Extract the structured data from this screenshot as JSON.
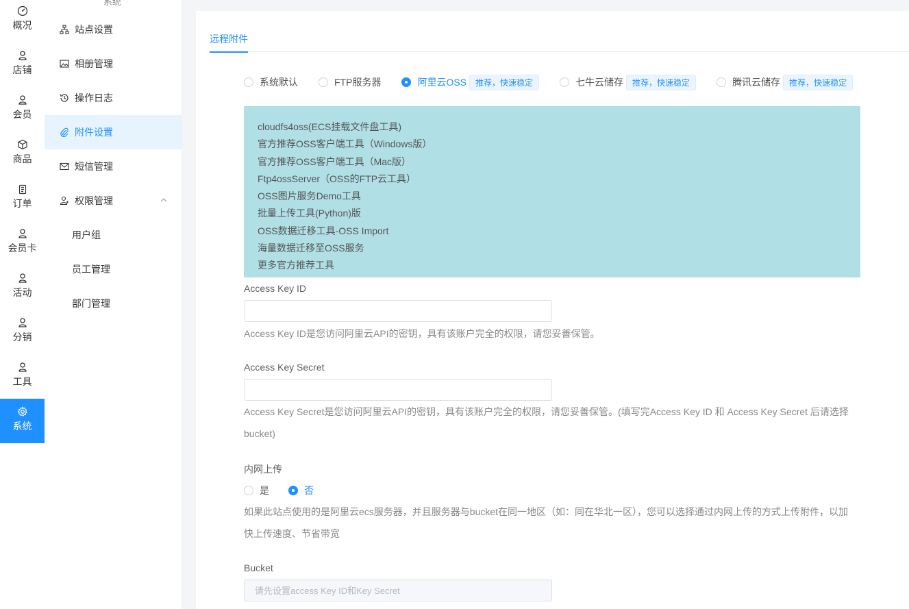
{
  "rail": {
    "items": [
      {
        "label": "概况",
        "icon": "dashboard-icon"
      },
      {
        "label": "店铺",
        "icon": "user-icon"
      },
      {
        "label": "会员",
        "icon": "user-icon"
      },
      {
        "label": "商品",
        "icon": "cube-icon"
      },
      {
        "label": "订单",
        "icon": "clipboard-icon"
      },
      {
        "label": "会员卡",
        "icon": "user-icon"
      },
      {
        "label": "活动",
        "icon": "user-icon"
      },
      {
        "label": "分销",
        "icon": "user-icon"
      },
      {
        "label": "工具",
        "icon": "user-icon"
      },
      {
        "label": "系统",
        "icon": "gear-icon",
        "active": true
      }
    ]
  },
  "sidebar": {
    "section_title": "系统",
    "items": [
      {
        "label": "站点设置",
        "icon": "sitemap-icon"
      },
      {
        "label": "相册管理",
        "icon": "image-icon"
      },
      {
        "label": "操作日志",
        "icon": "history-icon"
      },
      {
        "label": "附件设置",
        "icon": "paperclip-icon",
        "active": true
      },
      {
        "label": "短信管理",
        "icon": "mail-icon"
      },
      {
        "label": "权限管理",
        "icon": "user-group-icon",
        "expanded": true
      }
    ],
    "sub_items": [
      {
        "label": "用户组"
      },
      {
        "label": "员工管理"
      },
      {
        "label": "部门管理"
      }
    ]
  },
  "tabs": [
    {
      "label": "远程附件"
    }
  ],
  "storage_options": [
    {
      "label": "系统默认",
      "checked": false
    },
    {
      "label": "FTP服务器",
      "checked": false
    },
    {
      "label": "阿里云OSS",
      "checked": true,
      "tag": "推荐，快速稳定"
    },
    {
      "label": "七牛云储存",
      "checked": false,
      "tag": "推荐，快速稳定"
    },
    {
      "label": "腾讯云储存",
      "checked": false,
      "tag": "推荐，快速稳定"
    }
  ],
  "info_links": [
    "cloudfs4oss(ECS挂载文件盘工具)",
    "官方推荐OSS客户端工具（Windows版）",
    "官方推荐OSS客户端工具（Mac版）",
    "Ftp4ossServer（OSS的FTP云工具）",
    "OSS图片服务Demo工具",
    "批量上传工具(Python)版",
    "OSS数据迁移工具-OSS Import",
    "海量数据迁移至OSS服务",
    "更多官方推荐工具"
  ],
  "form": {
    "access_key_id": {
      "label": "Access Key ID",
      "value": "",
      "help": "Access Key ID是您访问阿里云API的密钥，具有该账户完全的权限，请您妥善保管。"
    },
    "access_key_secret": {
      "label": "Access Key Secret",
      "value": "",
      "help_line1": "Access Key Secret是您访问阿里云API的密钥，具有该账户完全的权限，请您妥善保管。(填写完Access Key ID 和 Access Key Secret 后请选择",
      "help_line2": "bucket)"
    },
    "intranet_upload": {
      "label": "内网上传",
      "yes_label": "是",
      "no_label": "否",
      "selected": "否",
      "help_line1": "如果此站点使用的是阿里云ecs服务器，并且服务器与bucket在同一地区（如：同在华北一区），您可以选择通过内网上传的方式上传附件，以加",
      "help_line2": "快上传速度、节省带宽"
    },
    "bucket": {
      "label": "Bucket",
      "placeholder": "请先设置access Key ID和Key Secret"
    }
  },
  "colors": {
    "accent": "#1e90ff",
    "info_bg": "#b0dfe5"
  }
}
